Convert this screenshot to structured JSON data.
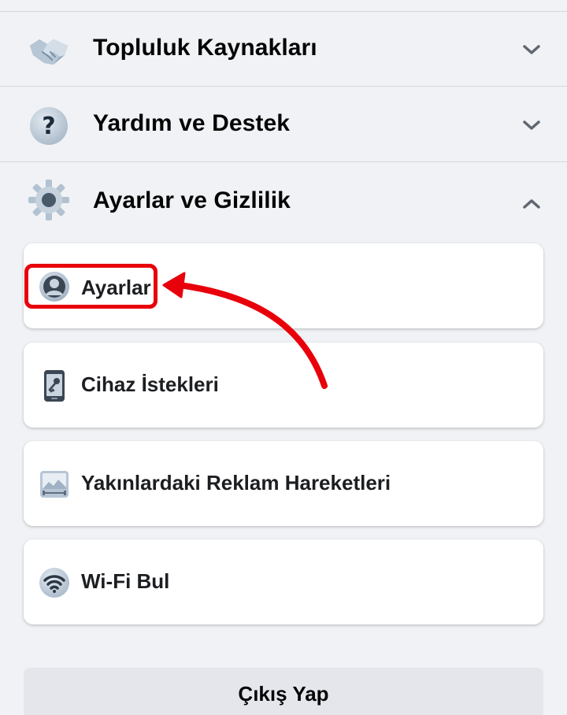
{
  "sections": [
    {
      "label": "Topluluk Kaynakları",
      "icon": "handshake-icon",
      "expanded": false
    },
    {
      "label": "Yardım ve Destek",
      "icon": "question-icon",
      "expanded": false
    },
    {
      "label": "Ayarlar ve Gizlilik",
      "icon": "gear-icon",
      "expanded": true
    }
  ],
  "settings_items": [
    {
      "label": "Ayarlar",
      "icon": "user-icon",
      "highlighted": true
    },
    {
      "label": "Cihaz İstekleri",
      "icon": "phone-key-icon"
    },
    {
      "label": "Yakınlardaki Reklam Hareketleri",
      "icon": "ad-activity-icon"
    },
    {
      "label": "Wi-Fi Bul",
      "icon": "wifi-icon"
    }
  ],
  "logout": {
    "label": "Çıkış Yap"
  },
  "colors": {
    "background": "#f0f2f5",
    "card": "#ffffff",
    "annotation": "#e8000b",
    "logout_bg": "#e4e6eb"
  }
}
